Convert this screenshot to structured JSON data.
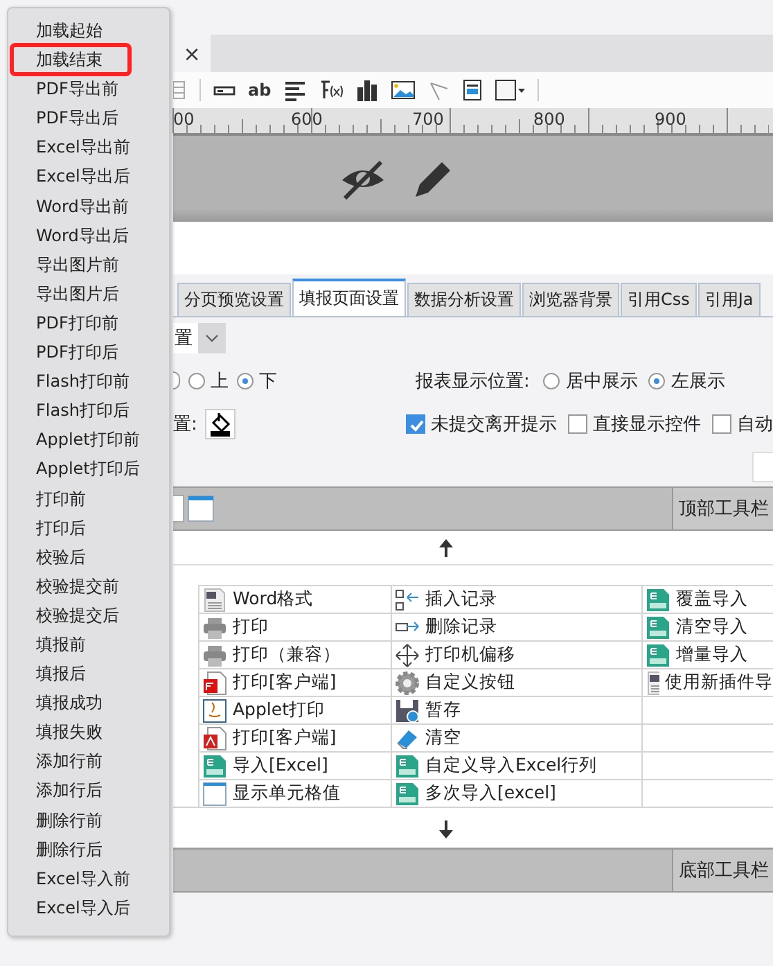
{
  "menu": {
    "items": [
      {
        "label": "加载起始",
        "highlighted": false
      },
      {
        "label": "加载结束",
        "highlighted": true
      },
      {
        "label": "PDF导出前",
        "highlighted": false
      },
      {
        "label": "PDF导出后",
        "highlighted": false
      },
      {
        "label": "Excel导出前",
        "highlighted": false
      },
      {
        "label": "Excel导出后",
        "highlighted": false
      },
      {
        "label": "Word导出前",
        "highlighted": false
      },
      {
        "label": "Word导出后",
        "highlighted": false
      },
      {
        "label": "导出图片前",
        "highlighted": false
      },
      {
        "label": "导出图片后",
        "highlighted": false
      },
      {
        "label": "PDF打印前",
        "highlighted": false
      },
      {
        "label": "PDF打印后",
        "highlighted": false
      },
      {
        "label": "Flash打印前",
        "highlighted": false
      },
      {
        "label": "Flash打印后",
        "highlighted": false
      },
      {
        "label": "Applet打印前",
        "highlighted": false
      },
      {
        "label": "Applet打印后",
        "highlighted": false
      },
      {
        "label": "打印前",
        "highlighted": false
      },
      {
        "label": "打印后",
        "highlighted": false
      },
      {
        "label": "校验后",
        "highlighted": false
      },
      {
        "label": "校验提交前",
        "highlighted": false
      },
      {
        "label": "校验提交后",
        "highlighted": false
      },
      {
        "label": "填报前",
        "highlighted": false
      },
      {
        "label": "填报后",
        "highlighted": false
      },
      {
        "label": "填报成功",
        "highlighted": false
      },
      {
        "label": "填报失败",
        "highlighted": false
      },
      {
        "label": "添加行前",
        "highlighted": false
      },
      {
        "label": "添加行后",
        "highlighted": false
      },
      {
        "label": "删除行前",
        "highlighted": false
      },
      {
        "label": "删除行后",
        "highlighted": false
      },
      {
        "label": "Excel导入前",
        "highlighted": false
      },
      {
        "label": "Excel导入后",
        "highlighted": false
      }
    ]
  },
  "editor_tab": {
    "close": "×"
  },
  "toolbar": {
    "label_tool": "ab"
  },
  "ruler": {
    "labels": [
      "00",
      "600",
      "700",
      "800",
      "900"
    ]
  },
  "settings_tabs": [
    {
      "label": "分页预览设置",
      "selected": false
    },
    {
      "label": "填报页面设置",
      "selected": true
    },
    {
      "label": "数据分析设置",
      "selected": false
    },
    {
      "label": "浏览器背景",
      "selected": false
    },
    {
      "label": "引用Css",
      "selected": false
    },
    {
      "label": "引用Ja",
      "selected": false
    }
  ],
  "settings": {
    "dropdown": {
      "value": "置"
    },
    "cut_option": {
      "selected": false
    },
    "toolbar_position": [
      {
        "label": "上",
        "selected": false
      },
      {
        "label": "下",
        "selected": true
      }
    ],
    "background_label": "置:",
    "display_position_label": "报表显示位置:",
    "display_position": [
      {
        "label": "居中展示",
        "selected": false
      },
      {
        "label": "左展示",
        "selected": true
      }
    ],
    "checkboxes": [
      {
        "label": "未提交离开提示",
        "checked": true
      },
      {
        "label": "直接显示控件",
        "checked": false
      },
      {
        "label": "自动",
        "checked": false
      }
    ]
  },
  "top_toolbar": {
    "label": "顶部工具栏"
  },
  "buttons_table": {
    "rows": [
      [
        {
          "label": "Word格式",
          "kind": "word"
        },
        {
          "label": "插入记录",
          "kind": "insert"
        },
        {
          "label": "覆盖导入",
          "kind": "excel"
        }
      ],
      [
        {
          "label": "打印",
          "kind": "printer"
        },
        {
          "label": "删除记录",
          "kind": "delete"
        },
        {
          "label": "清空导入",
          "kind": "excel"
        }
      ],
      [
        {
          "label": "打印（兼容）",
          "kind": "printer"
        },
        {
          "label": "打印机偏移",
          "kind": "move"
        },
        {
          "label": "增量导入",
          "kind": "excel"
        }
      ],
      [
        {
          "label": "打印[客户端]",
          "kind": "flash"
        },
        {
          "label": "自定义按钮",
          "kind": "gear"
        },
        {
          "label": "使用新插件导",
          "kind": "word"
        }
      ],
      [
        {
          "label": "Applet打印",
          "kind": "java"
        },
        {
          "label": "暂存",
          "kind": "save"
        }
      ],
      [
        {
          "label": "打印[客户端]",
          "kind": "pdf"
        },
        {
          "label": "清空",
          "kind": "eraser"
        }
      ],
      [
        {
          "label": "导入[Excel]",
          "kind": "excel"
        },
        {
          "label": "自定义导入Excel行列",
          "kind": "excel"
        }
      ],
      [
        {
          "label": "显示单元格值",
          "kind": "window"
        },
        {
          "label": "多次导入[excel]",
          "kind": "excel"
        }
      ]
    ]
  },
  "bottom_toolbar": {
    "label": "底部工具栏"
  }
}
